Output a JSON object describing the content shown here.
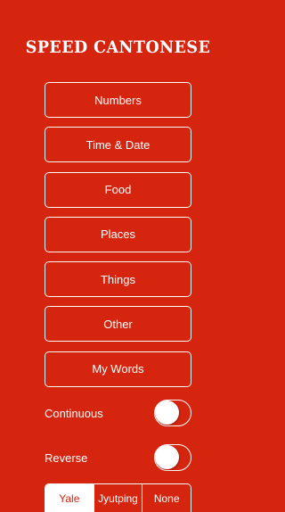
{
  "app_title": "SPEED CANTONESE",
  "menu": {
    "items": [
      {
        "label": "Numbers"
      },
      {
        "label": "Time & Date"
      },
      {
        "label": "Food"
      },
      {
        "label": "Places"
      },
      {
        "label": "Things"
      },
      {
        "label": "Other"
      },
      {
        "label": "My Words"
      }
    ]
  },
  "toggles": {
    "continuous": {
      "label": "Continuous",
      "state": "off"
    },
    "reverse": {
      "label": "Reverse",
      "state": "off"
    }
  },
  "romanization": {
    "options": [
      "Yale",
      "Jyutping",
      "None"
    ],
    "selected": "Yale"
  },
  "colors": {
    "background": "#D6250F",
    "foreground": "#FFFFFF"
  }
}
